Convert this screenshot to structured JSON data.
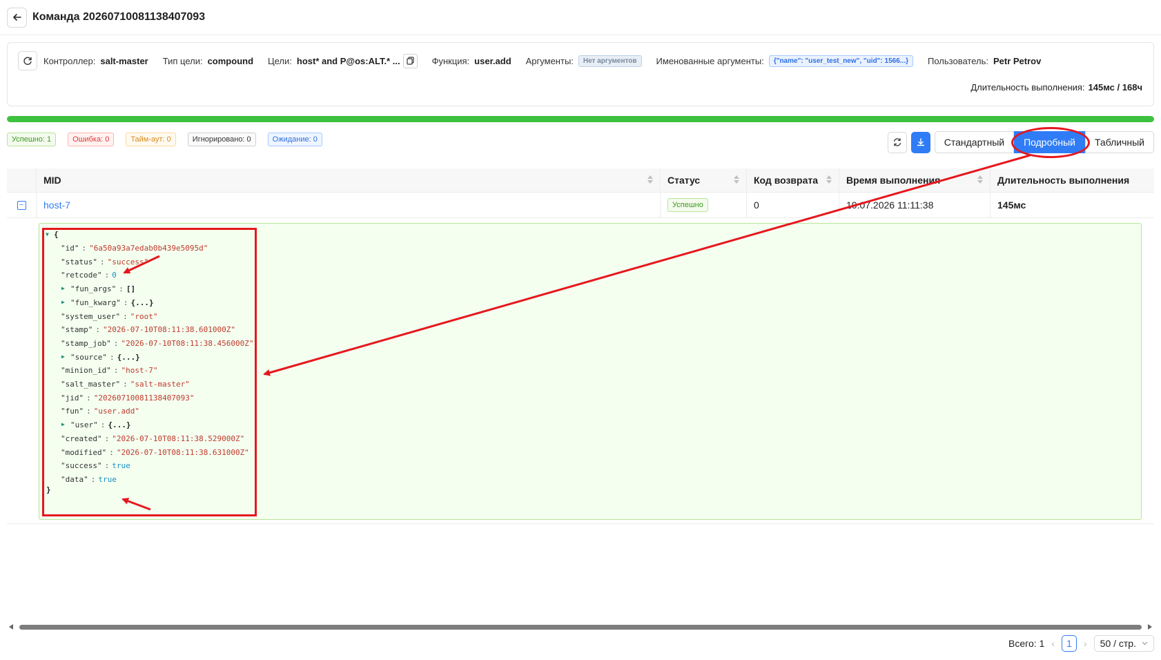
{
  "header": {
    "title": "Команда 20260710081138407093"
  },
  "info": {
    "controller_label": "Контроллер:",
    "controller_value": "salt-master",
    "target_type_label": "Тип цели:",
    "target_type_value": "compound",
    "targets_label": "Цели:",
    "targets_value": "host* and P@os:ALT.* ...",
    "function_label": "Функция:",
    "function_value": "user.add",
    "args_label": "Аргументы:",
    "args_value": "Нет аргументов",
    "kwargs_label": "Именованные аргументы:",
    "kwargs_value": "{\"name\": \"user_test_new\", \"uid\": 1566...}",
    "user_label": "Пользователь:",
    "user_value": "Petr Petrov",
    "duration_label": "Длительность выполнения:",
    "duration_value": "145мс / 168ч"
  },
  "progress": {
    "percent": 100,
    "color": "#3ec13e"
  },
  "status_tags": {
    "success": "Успешно: 1",
    "error": "Ошибка: 0",
    "timeout": "Тайм-аут: 0",
    "ignored": "Игнорировано: 0",
    "waiting": "Ожидание: 0"
  },
  "view_modes": {
    "standard": "Стандартный",
    "detailed": "Подробный",
    "table": "Табличный",
    "active": "detailed"
  },
  "table": {
    "headers": {
      "mid": "MID",
      "status": "Статус",
      "retcode": "Код возврата",
      "time": "Время выполнения",
      "duration": "Длительность выполнения"
    },
    "rows": [
      {
        "mid": "host-7",
        "status": "Успешно",
        "retcode": "0",
        "time": "10.07.2026 11:11:38",
        "duration": "145мс"
      }
    ]
  },
  "json_view": {
    "open_brace": "{",
    "close_brace": "}",
    "lines": [
      {
        "key": "\"id\"",
        "value": "\"6a50a93a7edab0b439e5095d\"",
        "vtype": "string"
      },
      {
        "key": "\"status\"",
        "value": "\"success\"",
        "vtype": "string"
      },
      {
        "key": "\"retcode\"",
        "value": "0",
        "vtype": "number"
      },
      {
        "key": "\"fun_args\"",
        "value": "[]",
        "vtype": "collapsed"
      },
      {
        "key": "\"fun_kwarg\"",
        "value": "{...}",
        "vtype": "collapsed"
      },
      {
        "key": "\"system_user\"",
        "value": "\"root\"",
        "vtype": "string"
      },
      {
        "key": "\"stamp\"",
        "value": "\"2026-07-10T08:11:38.601000Z\"",
        "vtype": "string"
      },
      {
        "key": "\"stamp_job\"",
        "value": "\"2026-07-10T08:11:38.456000Z\"",
        "vtype": "string"
      },
      {
        "key": "\"source\"",
        "value": "{...}",
        "vtype": "collapsed"
      },
      {
        "key": "\"minion_id\"",
        "value": "\"host-7\"",
        "vtype": "string"
      },
      {
        "key": "\"salt_master\"",
        "value": "\"salt-master\"",
        "vtype": "string"
      },
      {
        "key": "\"jid\"",
        "value": "\"20260710081138407093\"",
        "vtype": "string"
      },
      {
        "key": "\"fun\"",
        "value": "\"user.add\"",
        "vtype": "string"
      },
      {
        "key": "\"user\"",
        "value": "{...}",
        "vtype": "collapsed"
      },
      {
        "key": "\"created\"",
        "value": "\"2026-07-10T08:11:38.529000Z\"",
        "vtype": "string"
      },
      {
        "key": "\"modified\"",
        "value": "\"2026-07-10T08:11:38.631000Z\"",
        "vtype": "string"
      },
      {
        "key": "\"success\"",
        "value": "true",
        "vtype": "number"
      },
      {
        "key": "\"data\"",
        "value": "true",
        "vtype": "number"
      }
    ]
  },
  "pagination": {
    "total": "Всего: 1",
    "current": "1",
    "page_size": "50 / стр."
  },
  "annotation_color": "#e5171d"
}
